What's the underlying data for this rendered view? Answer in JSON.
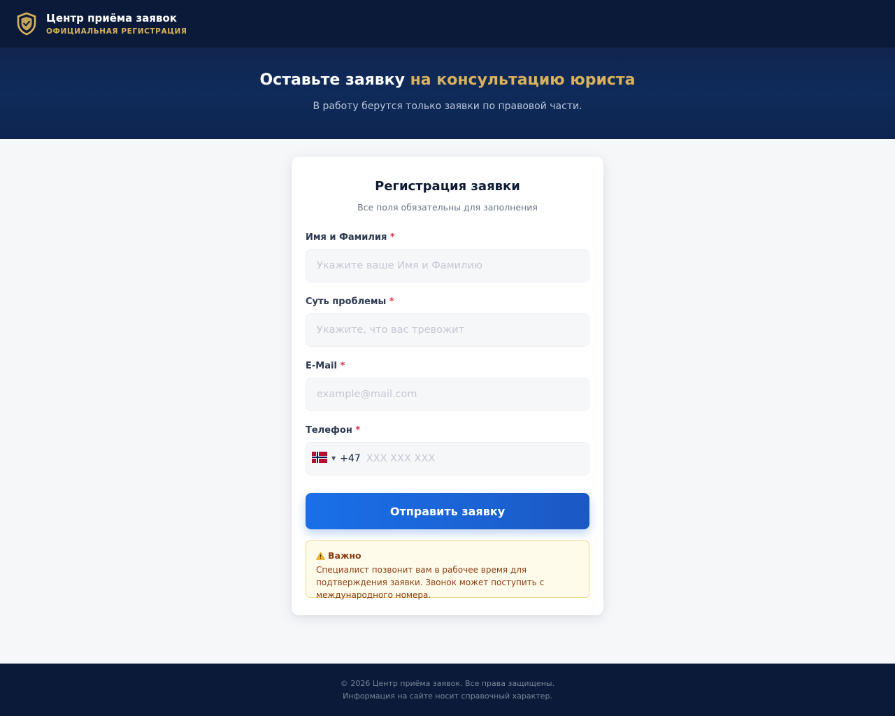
{
  "header": {
    "logo_icon": "shield-check-icon",
    "title": "Центр приёма заявок",
    "subtitle": "ОФИЦИАЛЬНАЯ РЕГИСТРАЦИЯ"
  },
  "hero": {
    "title_main": "Оставьте заявку ",
    "title_accent": "на консультацию юриста",
    "subtitle": "В работу берутся только заявки по правовой части."
  },
  "form": {
    "title": "Регистрация заявки",
    "subtitle": "Все поля обязательны для заполнения",
    "required_mark": "*",
    "fields": {
      "name": {
        "label": "Имя и Фамилия",
        "placeholder": "Укажите ваше Имя и Фамилию",
        "value": ""
      },
      "problem": {
        "label": "Суть проблемы",
        "placeholder": "Укажите, что вас тревожит",
        "value": ""
      },
      "email": {
        "label": "E-Mail",
        "placeholder": "example@mail.com",
        "value": ""
      },
      "phone": {
        "label": "Телефон",
        "country_icon": "norway-flag-icon",
        "dial_code": "+47",
        "placeholder": "XXX XXX XXX",
        "value": ""
      }
    },
    "submit_label": "Отправить заявку",
    "notice": {
      "icon": "warning-icon",
      "title": "Важно",
      "text": "Специалист позвонит вам в рабочее время для подтверждения заявки. Звонок может поступить с международного номера."
    }
  },
  "footer": {
    "line1": "© 2026 Центр приёма заявок. Все права защищены.",
    "line2": "Информация на сайте носит справочный характер."
  },
  "colors": {
    "navy": "#0b1a38",
    "gold": "#d9b25c",
    "primary": "#1b63d4",
    "notice_bg": "#fffbea",
    "notice_text": "#8a3d12",
    "required": "#d9344a"
  }
}
